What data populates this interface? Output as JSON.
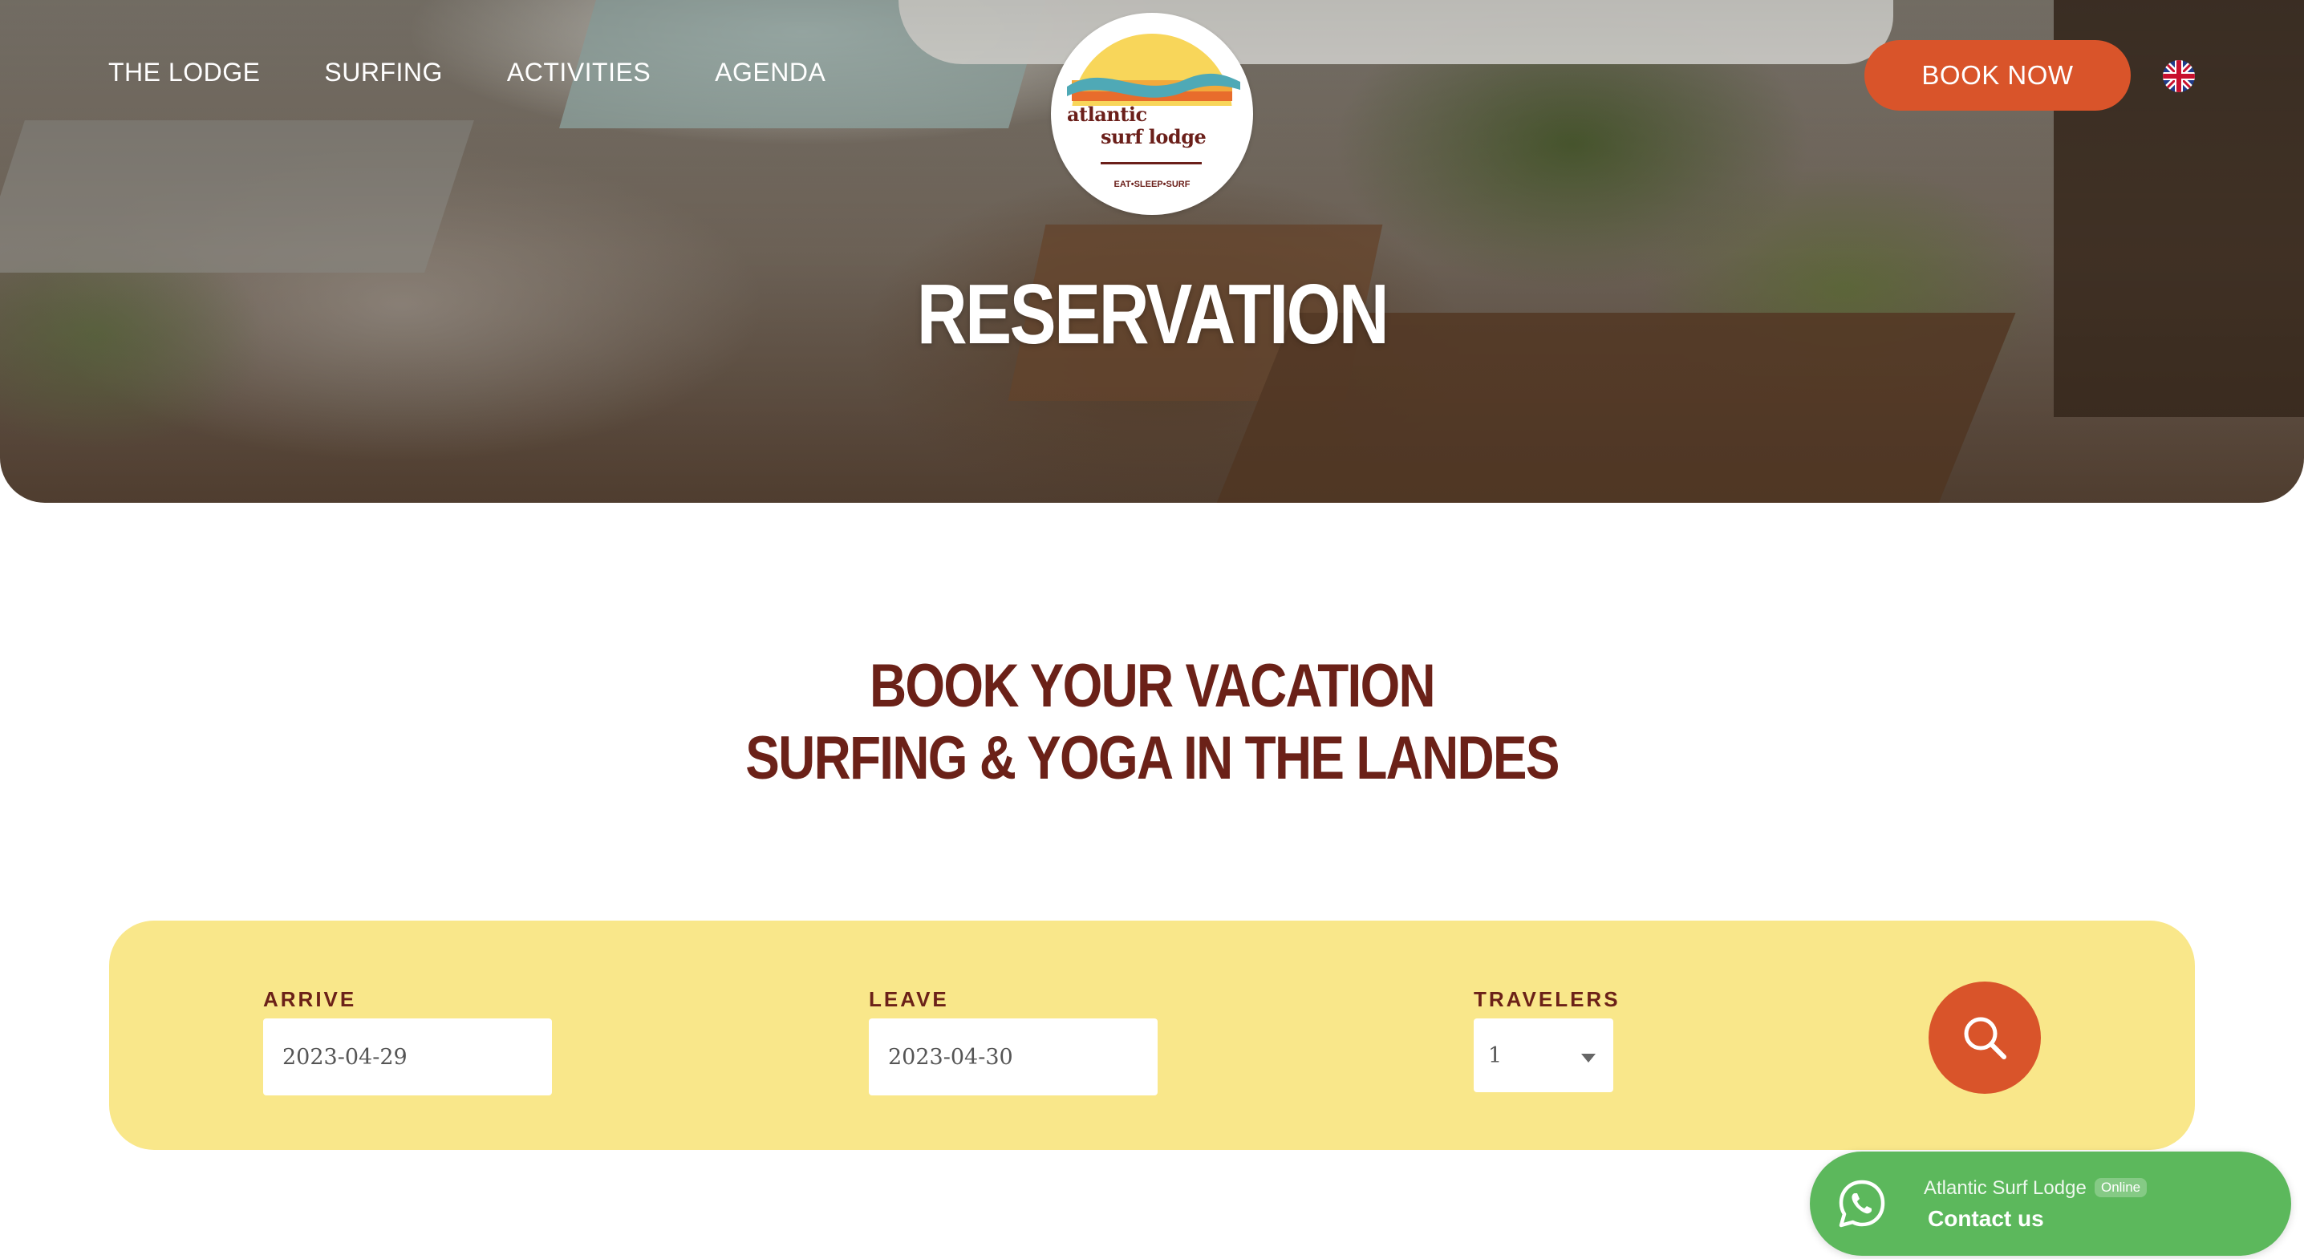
{
  "nav": {
    "items": [
      {
        "label": "THE LODGE"
      },
      {
        "label": "SURFING"
      },
      {
        "label": "ACTIVITIES"
      },
      {
        "label": "AGENDA"
      }
    ]
  },
  "logo": {
    "line1": "atlantic",
    "line2": "surf lodge",
    "tagline": "EAT•SLEEP•SURF"
  },
  "header": {
    "book_now_label": "BOOK NOW",
    "language_icon": "uk-flag-icon"
  },
  "hero": {
    "title": "RESERVATION"
  },
  "intro": {
    "heading_line1": "BOOK YOUR VACATION",
    "heading_line2": "SURFING & YOGA IN THE LANDES"
  },
  "booking": {
    "arrive_label": "ARRIVE",
    "arrive_value": "2023-04-29",
    "leave_label": "LEAVE",
    "leave_value": "2023-04-30",
    "travelers_label": "TRAVELERS",
    "travelers_value": "1",
    "search_icon": "search-icon"
  },
  "whatsapp": {
    "name": "Atlantic Surf Lodge",
    "status": "Online",
    "action": "Contact us",
    "icon": "whatsapp-icon"
  },
  "colors": {
    "accent_orange": "#d9542a",
    "brand_brown": "#6b2118",
    "booking_bg": "#f9e78a",
    "whatsapp_green": "#5cb85c"
  }
}
